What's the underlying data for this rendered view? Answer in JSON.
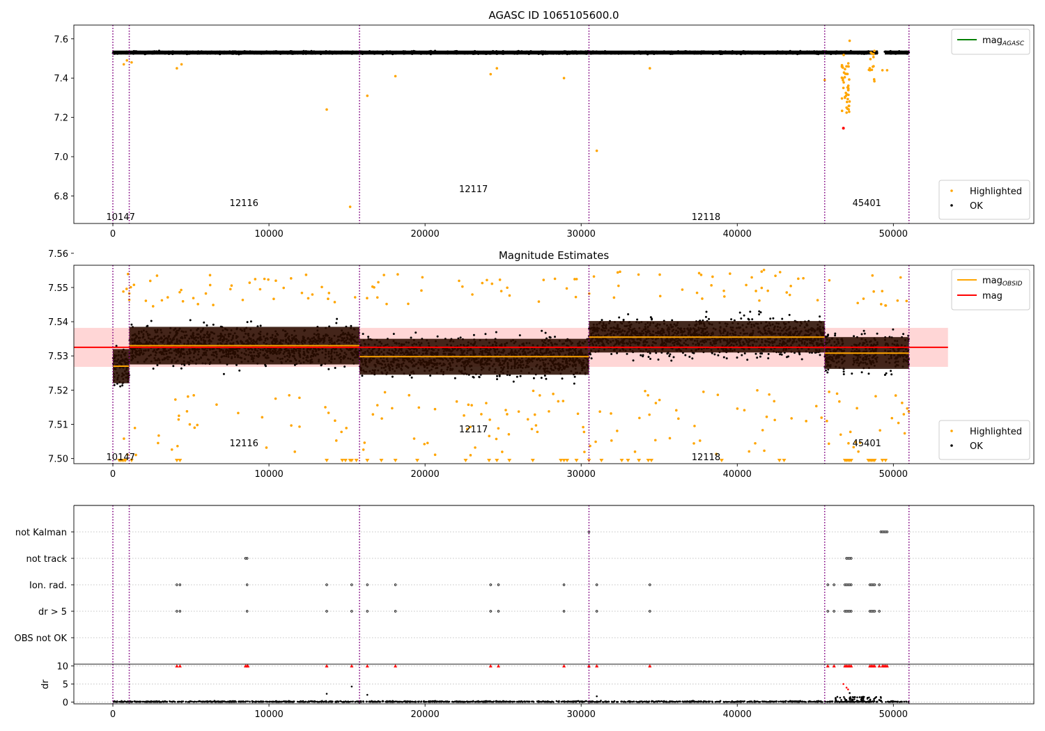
{
  "figure": {
    "titles": [
      "AGASC ID 1065105600.0",
      "Magnitude Estimates"
    ]
  },
  "chart_data": [
    {
      "type": "scatter",
      "title": "AGASC ID 1065105600.0",
      "xlabel": "",
      "ylabel": "",
      "xlim": [
        -2500,
        59000
      ],
      "ylim": [
        6.66,
        7.67
      ],
      "xticks": [
        "0",
        "10000",
        "20000",
        "30000",
        "40000",
        "50000"
      ],
      "yticks": [
        "6.8",
        "7.0",
        "7.2",
        "7.4",
        "7.6"
      ],
      "legend_upper": [
        {
          "label": "mag",
          "sub": "AGASC",
          "color": "#008000",
          "kind": "line"
        }
      ],
      "legend_lower": [
        {
          "label": "Highlighted",
          "color": "#ffa500",
          "kind": "dot"
        },
        {
          "label": "OK",
          "color": "#000000",
          "kind": "dot"
        }
      ],
      "legend_position": "upper right (line) / lower right (points)",
      "obsid_boundaries": [
        0,
        1050,
        15800,
        30500,
        45600,
        51000
      ],
      "obsid_labels": [
        {
          "text": "10147",
          "x": 500,
          "level": "low"
        },
        {
          "text": "12116",
          "x": 8400,
          "level": "mid"
        },
        {
          "text": "12117",
          "x": 23100,
          "level": "high"
        },
        {
          "text": "12118",
          "x": 38000,
          "level": "low"
        },
        {
          "text": "45401",
          "x": 48300,
          "level": "mid"
        }
      ],
      "series": [
        {
          "name": "OK",
          "baseline_segments": [
            [
              0,
              51000,
              7.53
            ]
          ]
        },
        {
          "name": "Highlighted",
          "points": [
            [
              700,
              7.47
            ],
            [
              900,
              7.49
            ],
            [
              1200,
              7.48
            ],
            [
              4100,
              7.45
            ],
            [
              4400,
              7.47
            ],
            [
              13700,
              7.24
            ],
            [
              15200,
              6.745
            ],
            [
              16300,
              7.31
            ],
            [
              18100,
              7.41
            ],
            [
              24200,
              7.42
            ],
            [
              24600,
              7.45
            ],
            [
              28900,
              7.4
            ],
            [
              31000,
              7.03
            ],
            [
              34400,
              7.45
            ],
            [
              45600,
              7.39
            ],
            [
              46800,
              7.35
            ],
            [
              46900,
              7.3
            ],
            [
              47000,
              7.25
            ],
            [
              47100,
              7.46
            ],
            [
              47200,
              7.59
            ],
            [
              48500,
              7.44
            ],
            [
              49300,
              7.44
            ],
            [
              49600,
              7.44
            ]
          ]
        },
        {
          "name": "red",
          "points": [
            [
              46800,
              7.145
            ]
          ]
        }
      ]
    },
    {
      "type": "scatter",
      "title": "Magnitude Estimates",
      "xlabel": "",
      "ylabel": "",
      "xlim": [
        -2500,
        59000
      ],
      "ylim": [
        7.4985,
        7.5565
      ],
      "xticks": [
        "0",
        "10000",
        "20000",
        "30000",
        "40000",
        "50000"
      ],
      "yticks": [
        "7.50",
        "7.51",
        "7.52",
        "7.53",
        "7.54",
        "7.55",
        "7.56"
      ],
      "legend_upper": [
        {
          "label": "mag",
          "sub": "OBSID",
          "color": "#ffa500",
          "kind": "line"
        },
        {
          "label": "mag",
          "sub": "",
          "color": "#ff0000",
          "kind": "line"
        }
      ],
      "legend_lower": [
        {
          "label": "Highlighted",
          "color": "#ffa500",
          "kind": "dot"
        },
        {
          "label": "OK",
          "color": "#000000",
          "kind": "dot"
        }
      ],
      "legend_position": "upper right (lines) / lower right (points)",
      "obsid_boundaries": [
        0,
        1050,
        15800,
        30500,
        45600,
        51000
      ],
      "obsid_labels": [
        {
          "text": "10147",
          "x": 500,
          "level": "low"
        },
        {
          "text": "12116",
          "x": 8400,
          "level": "mid"
        },
        {
          "text": "12117",
          "x": 23100,
          "level": "high"
        },
        {
          "text": "12118",
          "x": 38000,
          "level": "low"
        },
        {
          "text": "45401",
          "x": 48300,
          "level": "mid"
        }
      ],
      "mag_overall": {
        "value": 7.5325,
        "band": [
          7.5268,
          7.5382
        ],
        "x_range": [
          -2500,
          53500
        ]
      },
      "mag_obsid": [
        {
          "x0": 0,
          "x1": 1050,
          "value": 7.527,
          "band": [
            7.522,
            7.532
          ]
        },
        {
          "x0": 1050,
          "x1": 15800,
          "value": 7.533,
          "band": [
            7.5275,
            7.5385
          ]
        },
        {
          "x0": 15800,
          "x1": 30500,
          "value": 7.5298,
          "band": [
            7.5245,
            7.535
          ]
        },
        {
          "x0": 30500,
          "x1": 45600,
          "value": 7.5355,
          "band": [
            7.531,
            7.5402
          ]
        },
        {
          "x0": 45600,
          "x1": 51000,
          "value": 7.5308,
          "band": [
            7.5262,
            7.5355
          ]
        }
      ]
    },
    {
      "type": "scatter",
      "title": "",
      "xlabel": "",
      "ylabel": "",
      "xlim": [
        -2500,
        59000
      ],
      "xticks": [
        "0",
        "10000",
        "20000",
        "30000",
        "40000",
        "50000"
      ],
      "flag_rows": [
        "not Kalman",
        "not track",
        "Ion. rad.",
        "dr > 5",
        "OBS not OK"
      ],
      "flag_events": {
        "not Kalman": [
          30500,
          49200,
          49300,
          49400,
          49500,
          49600
        ],
        "not track": [
          8500,
          8600,
          47000,
          47100,
          47200,
          47300
        ],
        "Ion. rad.": [
          4100,
          4300,
          8600,
          13700,
          15300,
          16300,
          18100,
          24200,
          24700,
          28900,
          31000,
          34400,
          45800,
          46200,
          46900,
          47000,
          47100,
          47200,
          47300,
          48500,
          48600,
          48700,
          48800,
          49100
        ],
        "dr > 5": [
          4100,
          4300,
          8600,
          13700,
          15300,
          16300,
          18100,
          24200,
          24700,
          28900,
          31000,
          34400,
          45800,
          46200,
          46900,
          47000,
          47100,
          47200,
          47300,
          48500,
          48600,
          48700,
          48800,
          49100
        ],
        "OBS not OK": []
      },
      "obsid_boundaries": [
        0,
        1050,
        15800,
        30500,
        45600,
        51000
      ]
    },
    {
      "type": "scatter",
      "title": "",
      "xlabel": "",
      "ylabel": "dr",
      "xlim": [
        -2500,
        59000
      ],
      "ylim": [
        -0.5,
        10.5
      ],
      "xticks": [
        "0",
        "10000",
        "20000",
        "30000",
        "40000",
        "50000"
      ],
      "yticks": [
        "0",
        "5",
        "10"
      ],
      "obsid_boundaries": [
        0,
        1050,
        15800,
        30500,
        45600,
        51000
      ],
      "clipped_points": [
        4100,
        4300,
        8500,
        8600,
        8650,
        13700,
        15300,
        16300,
        18100,
        24200,
        24700,
        28900,
        30500,
        31000,
        34400,
        45800,
        46200,
        46900,
        47000,
        47100,
        47200,
        47300,
        48500,
        48600,
        48700,
        48800,
        49100,
        49300,
        49400,
        49500,
        49600
      ],
      "large_points": [
        [
          13700,
          2.3
        ],
        [
          15300,
          4.3
        ],
        [
          16300,
          2.0
        ],
        [
          31000,
          1.6
        ],
        [
          46800,
          5.0
        ],
        [
          47000,
          4.0
        ],
        [
          47100,
          3.5
        ],
        [
          47200,
          2.5
        ]
      ]
    }
  ],
  "colors": {
    "ok": "#000000",
    "highlighted": "#ffa500",
    "red": "#ff0000",
    "green": "#008000",
    "boundary": "#800080",
    "band": "#ffd6d6",
    "grid": "#b0b0b0"
  }
}
